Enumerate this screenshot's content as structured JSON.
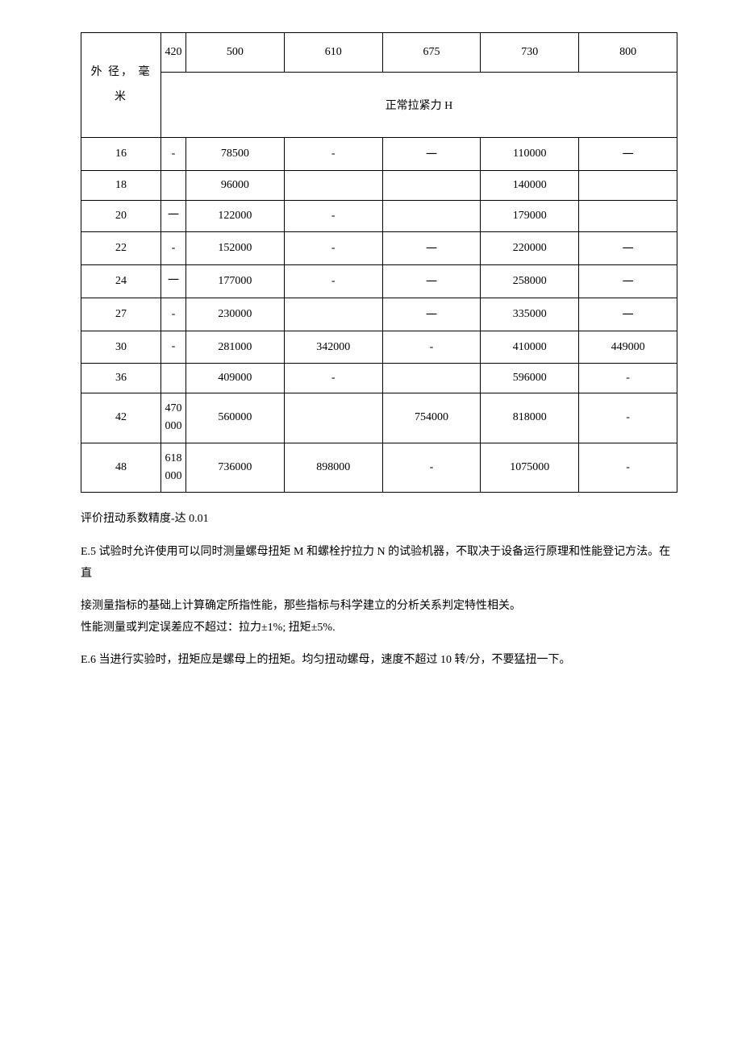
{
  "table": {
    "row_header": "外 径， 毫 米",
    "span_header": "正常拉紧力 Н",
    "col_headers": [
      "420",
      "500",
      "610",
      "675",
      "730",
      "800"
    ],
    "rows": [
      {
        "label": "16",
        "cells": [
          "-",
          "78500",
          "-",
          "一",
          "110000",
          "一"
        ]
      },
      {
        "label": "18",
        "cells": [
          "",
          "96000",
          "",
          "",
          "140000",
          ""
        ]
      },
      {
        "label": "20",
        "cells": [
          "一",
          "122000",
          "-",
          "",
          "179000",
          ""
        ]
      },
      {
        "label": "22",
        "cells": [
          "-",
          "152000",
          "-",
          "一",
          "220000",
          "一"
        ]
      },
      {
        "label": "24",
        "cells": [
          "一",
          "177000",
          "-",
          "一",
          "258000",
          "一"
        ]
      },
      {
        "label": "27",
        "cells": [
          "-",
          "230000",
          "",
          "一",
          "335000",
          "一"
        ]
      },
      {
        "label": "30",
        "cells": [
          "-",
          "281000",
          "342000",
          "-",
          "410000",
          "449000"
        ]
      },
      {
        "label": "36",
        "cells": [
          "",
          "409000",
          "-",
          "",
          "596000",
          "-"
        ]
      },
      {
        "label": "42",
        "cells": [
          "470000",
          "560000",
          "",
          "754000",
          "818000",
          "-"
        ]
      },
      {
        "label": "48",
        "cells": [
          "618000",
          "736000",
          "898000",
          "-",
          "1075000",
          "-"
        ]
      }
    ]
  },
  "notes": {
    "p1": "评价扭动系数精度-达 0.01",
    "p2": "E.5 试验时允许使用可以同时测量螺母扭矩 M 和螺栓拧拉力 N 的试验机器，不取决于设备运行原理和性能登记方法。在直",
    "p3a": "接测量指标的基础上计算确定所指性能，那些指标与科学建立的分析关系判定特性相关。",
    "p3b": "性能测量或判定误差应不超过：拉力±1%; 扭矩±5%.",
    "p4": "E.6 当进行实验时，扭矩应是螺母上的扭矩。均匀扭动螺母，速度不超过 10 转/分，不要猛扭一下。"
  },
  "chart_data": {
    "type": "table",
    "title": "正常拉紧力 Н",
    "row_label": "外径，毫米",
    "columns": [
      420,
      500,
      610,
      675,
      730,
      800
    ],
    "rows": [
      {
        "d": 16,
        "values": [
          null,
          78500,
          null,
          null,
          110000,
          null
        ]
      },
      {
        "d": 18,
        "values": [
          null,
          96000,
          null,
          null,
          140000,
          null
        ]
      },
      {
        "d": 20,
        "values": [
          null,
          122000,
          null,
          null,
          179000,
          null
        ]
      },
      {
        "d": 22,
        "values": [
          null,
          152000,
          null,
          null,
          220000,
          null
        ]
      },
      {
        "d": 24,
        "values": [
          null,
          177000,
          null,
          null,
          258000,
          null
        ]
      },
      {
        "d": 27,
        "values": [
          null,
          230000,
          null,
          null,
          335000,
          null
        ]
      },
      {
        "d": 30,
        "values": [
          null,
          281000,
          342000,
          null,
          410000,
          449000
        ]
      },
      {
        "d": 36,
        "values": [
          null,
          409000,
          null,
          null,
          596000,
          null
        ]
      },
      {
        "d": 42,
        "values": [
          470000,
          560000,
          null,
          754000,
          818000,
          null
        ]
      },
      {
        "d": 48,
        "values": [
          618000,
          736000,
          898000,
          null,
          1075000,
          null
        ]
      }
    ]
  }
}
